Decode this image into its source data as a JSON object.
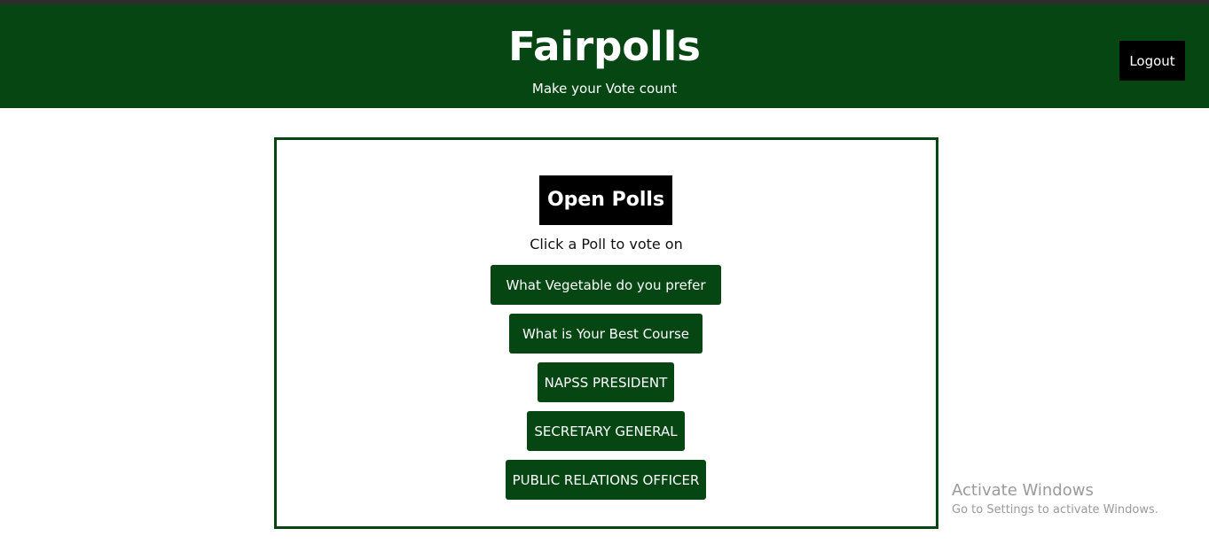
{
  "header": {
    "brand": "Fairpolls",
    "tagline": "Make your Vote count",
    "logout_label": "Logout"
  },
  "polls_panel": {
    "title": "Open Polls",
    "instruction": "Click a Poll to vote on",
    "polls": [
      {
        "label": "What Vegetable do you prefer"
      },
      {
        "label": "What is Your Best Course"
      },
      {
        "label": "NAPSS PRESIDENT"
      },
      {
        "label": "SECRETARY GENERAL"
      },
      {
        "label": "PUBLIC RELATIONS OFFICER"
      }
    ]
  },
  "watermark": {
    "title": "Activate Windows",
    "subtitle": "Go to Settings to activate Windows."
  },
  "colors": {
    "brand_green": "#054613",
    "black": "#000000",
    "white": "#ffffff"
  }
}
